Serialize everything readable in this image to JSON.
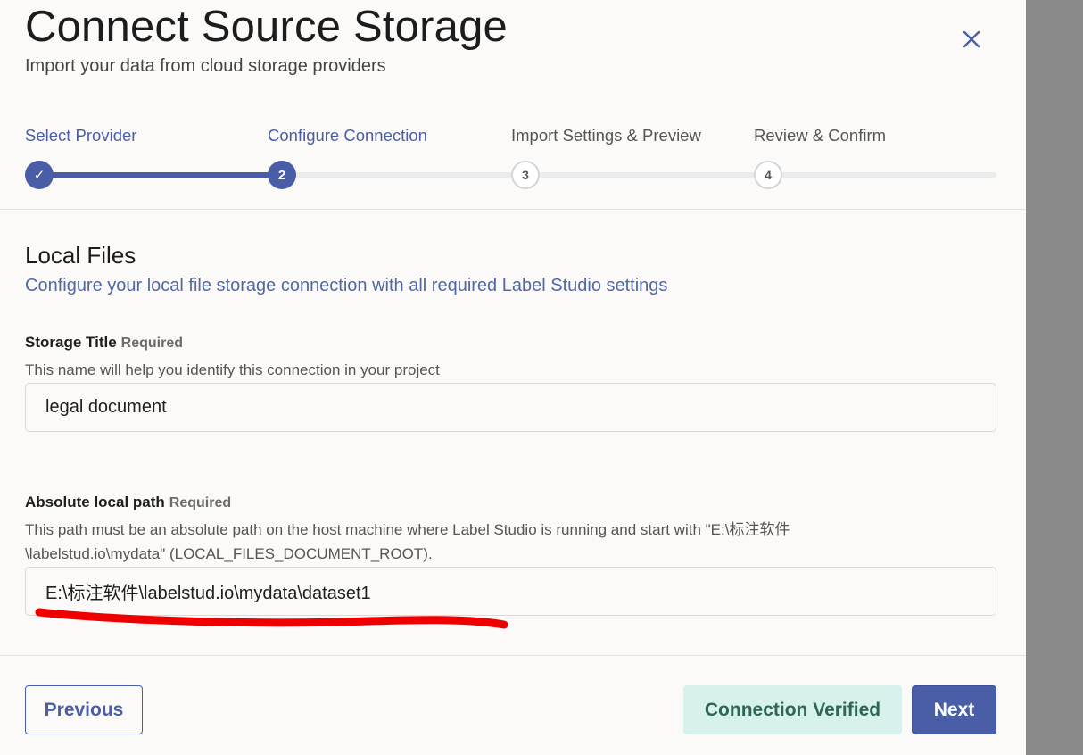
{
  "header": {
    "title": "Connect Source Storage",
    "subtitle": "Import your data from cloud storage providers",
    "close_icon": "close-icon"
  },
  "stepper": {
    "steps": [
      {
        "label": "Select Provider",
        "marker": "✓",
        "state": "done"
      },
      {
        "label": "Configure Connection",
        "marker": "2",
        "state": "active"
      },
      {
        "label": "Import Settings & Preview",
        "marker": "3",
        "state": "todo"
      },
      {
        "label": "Review & Confirm",
        "marker": "4",
        "state": "todo"
      }
    ]
  },
  "section": {
    "title": "Local Files",
    "description": "Configure your local file storage connection with all required Label Studio settings"
  },
  "fields": {
    "storage_title": {
      "label": "Storage Title",
      "required": "Required",
      "help": "This name will help you identify this connection in your project",
      "value": "legal document"
    },
    "local_path": {
      "label": "Absolute local path",
      "required": "Required",
      "help": "This path must be an absolute path on the host machine where Label Studio is running and start with \"E:\\标注软件\\labelstud.io\\mydata\" (LOCAL_FILES_DOCUMENT_ROOT).",
      "value": "E:\\标注软件\\labelstud.io\\mydata\\dataset1"
    }
  },
  "footer": {
    "previous_label": "Previous",
    "verified_label": "Connection Verified",
    "next_label": "Next"
  },
  "colors": {
    "accent": "#4a5ea8",
    "verified_bg": "#d7f2ec",
    "verified_text": "#2d6654",
    "annotation": "#ee0000"
  }
}
